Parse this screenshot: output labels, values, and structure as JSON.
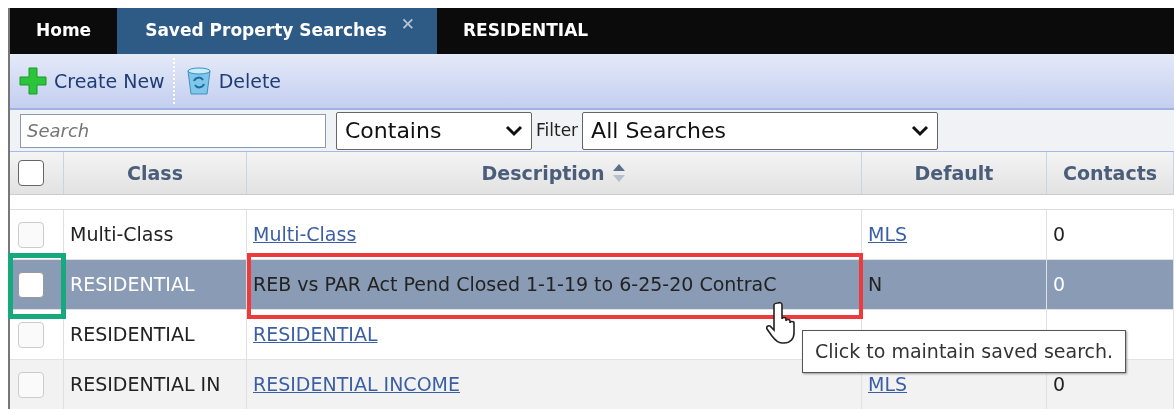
{
  "tabs": [
    {
      "label": "Home",
      "selected": false,
      "closable": false
    },
    {
      "label": "Saved Property Searches",
      "selected": true,
      "closable": true,
      "close_glyph": "✕"
    },
    {
      "label": "RESIDENTIAL",
      "selected": false,
      "closable": false
    }
  ],
  "toolbar": {
    "buttons": [
      {
        "label": "Create New",
        "kind": "create"
      },
      {
        "label": "Delete",
        "kind": "delete"
      }
    ]
  },
  "filter_bar": {
    "search": {
      "placeholder": "Search"
    },
    "match_select": {
      "value": "Contains"
    },
    "filter_label": "Filter",
    "filter_select": {
      "value": "All Searches"
    }
  },
  "table": {
    "header_checkbox": {
      "checked": false
    },
    "columns": [
      {
        "label": "Class",
        "sorted": false
      },
      {
        "label": "Description",
        "sorted": true
      },
      {
        "label": "Default",
        "sorted": false
      },
      {
        "label": "Contacts",
        "sorted": false
      }
    ],
    "rows": [
      {
        "selected": false,
        "checked": false,
        "highlighted": false,
        "class": "Multi-Class",
        "description": "Multi-Class",
        "description_link": true,
        "default": "MLS",
        "default_link": true,
        "contacts": "0"
      },
      {
        "selected": true,
        "checked": false,
        "highlighted": true,
        "class": "RESIDENTIAL",
        "description": "REB vs PAR Act Pend Closed 1-1-19 to 6-25-20 ContraC",
        "description_link": false,
        "default": "N",
        "default_link": false,
        "contacts": "0"
      },
      {
        "selected": false,
        "checked": false,
        "highlighted": false,
        "class": "RESIDENTIAL",
        "description": "RESIDENTIAL",
        "description_link": true
      },
      {
        "selected": false,
        "checked": false,
        "highlighted": false,
        "class": "RESIDENTIAL IN",
        "description": "RESIDENTIAL INCOME",
        "description_link": true,
        "default": "MLS",
        "default_link": true,
        "contacts": "0"
      }
    ]
  },
  "tooltip": {
    "text": "Click to maintain saved search."
  }
}
